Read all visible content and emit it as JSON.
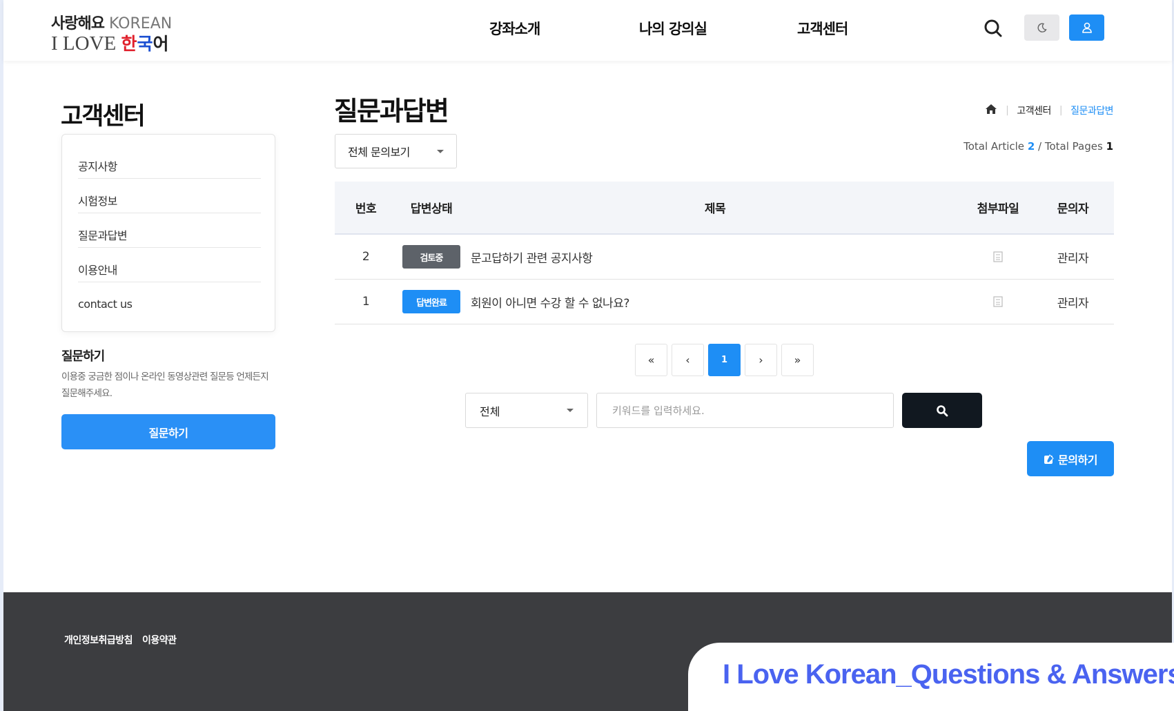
{
  "header": {
    "logo": {
      "line1_ko": "사랑해요",
      "line1_en": " KOREAN",
      "line2_prefix": "I LOVE ",
      "line2_han": "한",
      "line2_guk": "국",
      "line2_eo": "어"
    },
    "nav": [
      "강좌소개",
      "나의 강의실",
      "고객센터"
    ],
    "icons": {
      "search": "search-icon",
      "theme": "moon-icon",
      "user": "user-icon"
    }
  },
  "sidebar": {
    "title": "고객센터",
    "items": [
      "공지사항",
      "시험정보",
      "질문과답변",
      "이용안내",
      "contact us"
    ],
    "ask_title": "질문하기",
    "ask_desc": "이용중 궁금한 점이나 온라인 동영상관련 질문등 언제든지 질문해주세요.",
    "ask_button": "질문하기"
  },
  "main": {
    "title": "질문과답변",
    "breadcrumb": {
      "home_icon": "home-icon",
      "level1": "고객센터",
      "level2": "질문과답변"
    },
    "filter_select": "전체 문의보기",
    "totals": {
      "article_label": "Total Article",
      "article_count": "2",
      "separator": " / ",
      "pages_label": "Total Pages",
      "pages_count": "1"
    },
    "table": {
      "headers": {
        "no": "번호",
        "status": "답변상태",
        "title": "제목",
        "file": "첨부파일",
        "author": "문의자"
      },
      "rows": [
        {
          "no": "2",
          "status": "검토중",
          "title": "문고답하기 관련 공지사항",
          "file_icon": "file-icon",
          "author": "관리자"
        },
        {
          "no": "1",
          "status": "답변완료",
          "title": "회원이 아니면 수강 할 수 없나요?",
          "file_icon": "file-icon",
          "author": "관리자"
        }
      ]
    },
    "pagination": {
      "first": "«",
      "prev": "‹",
      "current": "1",
      "next": "›",
      "last": "»"
    },
    "search": {
      "select_value": "전체",
      "placeholder": "키워드를 입력하세요."
    },
    "inquiry_button": "문의하기"
  },
  "footer": {
    "links": [
      "개인정보취급방침",
      "이용약관"
    ]
  },
  "caption": "I Love Korean_Questions & Answers",
  "colors": {
    "accent": "#1e8ef5",
    "review_badge": "#5d6269",
    "footer_bg": "#3c3d40",
    "search_btn": "#111820",
    "caption": "#4a63f0"
  }
}
